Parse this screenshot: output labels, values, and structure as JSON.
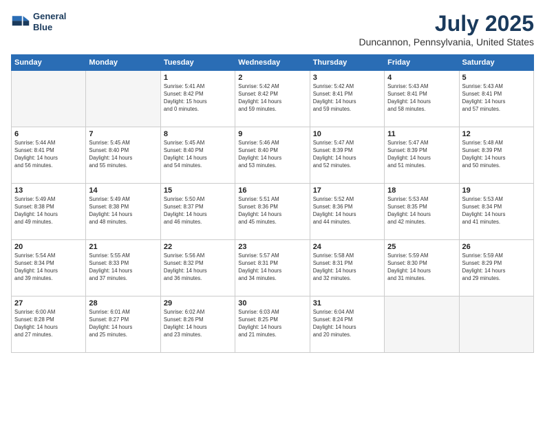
{
  "logo": {
    "line1": "General",
    "line2": "Blue"
  },
  "title": "July 2025",
  "location": "Duncannon, Pennsylvania, United States",
  "weekdays": [
    "Sunday",
    "Monday",
    "Tuesday",
    "Wednesday",
    "Thursday",
    "Friday",
    "Saturday"
  ],
  "weeks": [
    [
      {
        "day": "",
        "detail": ""
      },
      {
        "day": "",
        "detail": ""
      },
      {
        "day": "1",
        "detail": "Sunrise: 5:41 AM\nSunset: 8:42 PM\nDaylight: 15 hours\nand 0 minutes."
      },
      {
        "day": "2",
        "detail": "Sunrise: 5:42 AM\nSunset: 8:42 PM\nDaylight: 14 hours\nand 59 minutes."
      },
      {
        "day": "3",
        "detail": "Sunrise: 5:42 AM\nSunset: 8:41 PM\nDaylight: 14 hours\nand 59 minutes."
      },
      {
        "day": "4",
        "detail": "Sunrise: 5:43 AM\nSunset: 8:41 PM\nDaylight: 14 hours\nand 58 minutes."
      },
      {
        "day": "5",
        "detail": "Sunrise: 5:43 AM\nSunset: 8:41 PM\nDaylight: 14 hours\nand 57 minutes."
      }
    ],
    [
      {
        "day": "6",
        "detail": "Sunrise: 5:44 AM\nSunset: 8:41 PM\nDaylight: 14 hours\nand 56 minutes."
      },
      {
        "day": "7",
        "detail": "Sunrise: 5:45 AM\nSunset: 8:40 PM\nDaylight: 14 hours\nand 55 minutes."
      },
      {
        "day": "8",
        "detail": "Sunrise: 5:45 AM\nSunset: 8:40 PM\nDaylight: 14 hours\nand 54 minutes."
      },
      {
        "day": "9",
        "detail": "Sunrise: 5:46 AM\nSunset: 8:40 PM\nDaylight: 14 hours\nand 53 minutes."
      },
      {
        "day": "10",
        "detail": "Sunrise: 5:47 AM\nSunset: 8:39 PM\nDaylight: 14 hours\nand 52 minutes."
      },
      {
        "day": "11",
        "detail": "Sunrise: 5:47 AM\nSunset: 8:39 PM\nDaylight: 14 hours\nand 51 minutes."
      },
      {
        "day": "12",
        "detail": "Sunrise: 5:48 AM\nSunset: 8:39 PM\nDaylight: 14 hours\nand 50 minutes."
      }
    ],
    [
      {
        "day": "13",
        "detail": "Sunrise: 5:49 AM\nSunset: 8:38 PM\nDaylight: 14 hours\nand 49 minutes."
      },
      {
        "day": "14",
        "detail": "Sunrise: 5:49 AM\nSunset: 8:38 PM\nDaylight: 14 hours\nand 48 minutes."
      },
      {
        "day": "15",
        "detail": "Sunrise: 5:50 AM\nSunset: 8:37 PM\nDaylight: 14 hours\nand 46 minutes."
      },
      {
        "day": "16",
        "detail": "Sunrise: 5:51 AM\nSunset: 8:36 PM\nDaylight: 14 hours\nand 45 minutes."
      },
      {
        "day": "17",
        "detail": "Sunrise: 5:52 AM\nSunset: 8:36 PM\nDaylight: 14 hours\nand 44 minutes."
      },
      {
        "day": "18",
        "detail": "Sunrise: 5:53 AM\nSunset: 8:35 PM\nDaylight: 14 hours\nand 42 minutes."
      },
      {
        "day": "19",
        "detail": "Sunrise: 5:53 AM\nSunset: 8:34 PM\nDaylight: 14 hours\nand 41 minutes."
      }
    ],
    [
      {
        "day": "20",
        "detail": "Sunrise: 5:54 AM\nSunset: 8:34 PM\nDaylight: 14 hours\nand 39 minutes."
      },
      {
        "day": "21",
        "detail": "Sunrise: 5:55 AM\nSunset: 8:33 PM\nDaylight: 14 hours\nand 37 minutes."
      },
      {
        "day": "22",
        "detail": "Sunrise: 5:56 AM\nSunset: 8:32 PM\nDaylight: 14 hours\nand 36 minutes."
      },
      {
        "day": "23",
        "detail": "Sunrise: 5:57 AM\nSunset: 8:31 PM\nDaylight: 14 hours\nand 34 minutes."
      },
      {
        "day": "24",
        "detail": "Sunrise: 5:58 AM\nSunset: 8:31 PM\nDaylight: 14 hours\nand 32 minutes."
      },
      {
        "day": "25",
        "detail": "Sunrise: 5:59 AM\nSunset: 8:30 PM\nDaylight: 14 hours\nand 31 minutes."
      },
      {
        "day": "26",
        "detail": "Sunrise: 5:59 AM\nSunset: 8:29 PM\nDaylight: 14 hours\nand 29 minutes."
      }
    ],
    [
      {
        "day": "27",
        "detail": "Sunrise: 6:00 AM\nSunset: 8:28 PM\nDaylight: 14 hours\nand 27 minutes."
      },
      {
        "day": "28",
        "detail": "Sunrise: 6:01 AM\nSunset: 8:27 PM\nDaylight: 14 hours\nand 25 minutes."
      },
      {
        "day": "29",
        "detail": "Sunrise: 6:02 AM\nSunset: 8:26 PM\nDaylight: 14 hours\nand 23 minutes."
      },
      {
        "day": "30",
        "detail": "Sunrise: 6:03 AM\nSunset: 8:25 PM\nDaylight: 14 hours\nand 21 minutes."
      },
      {
        "day": "31",
        "detail": "Sunrise: 6:04 AM\nSunset: 8:24 PM\nDaylight: 14 hours\nand 20 minutes."
      },
      {
        "day": "",
        "detail": ""
      },
      {
        "day": "",
        "detail": ""
      }
    ]
  ]
}
